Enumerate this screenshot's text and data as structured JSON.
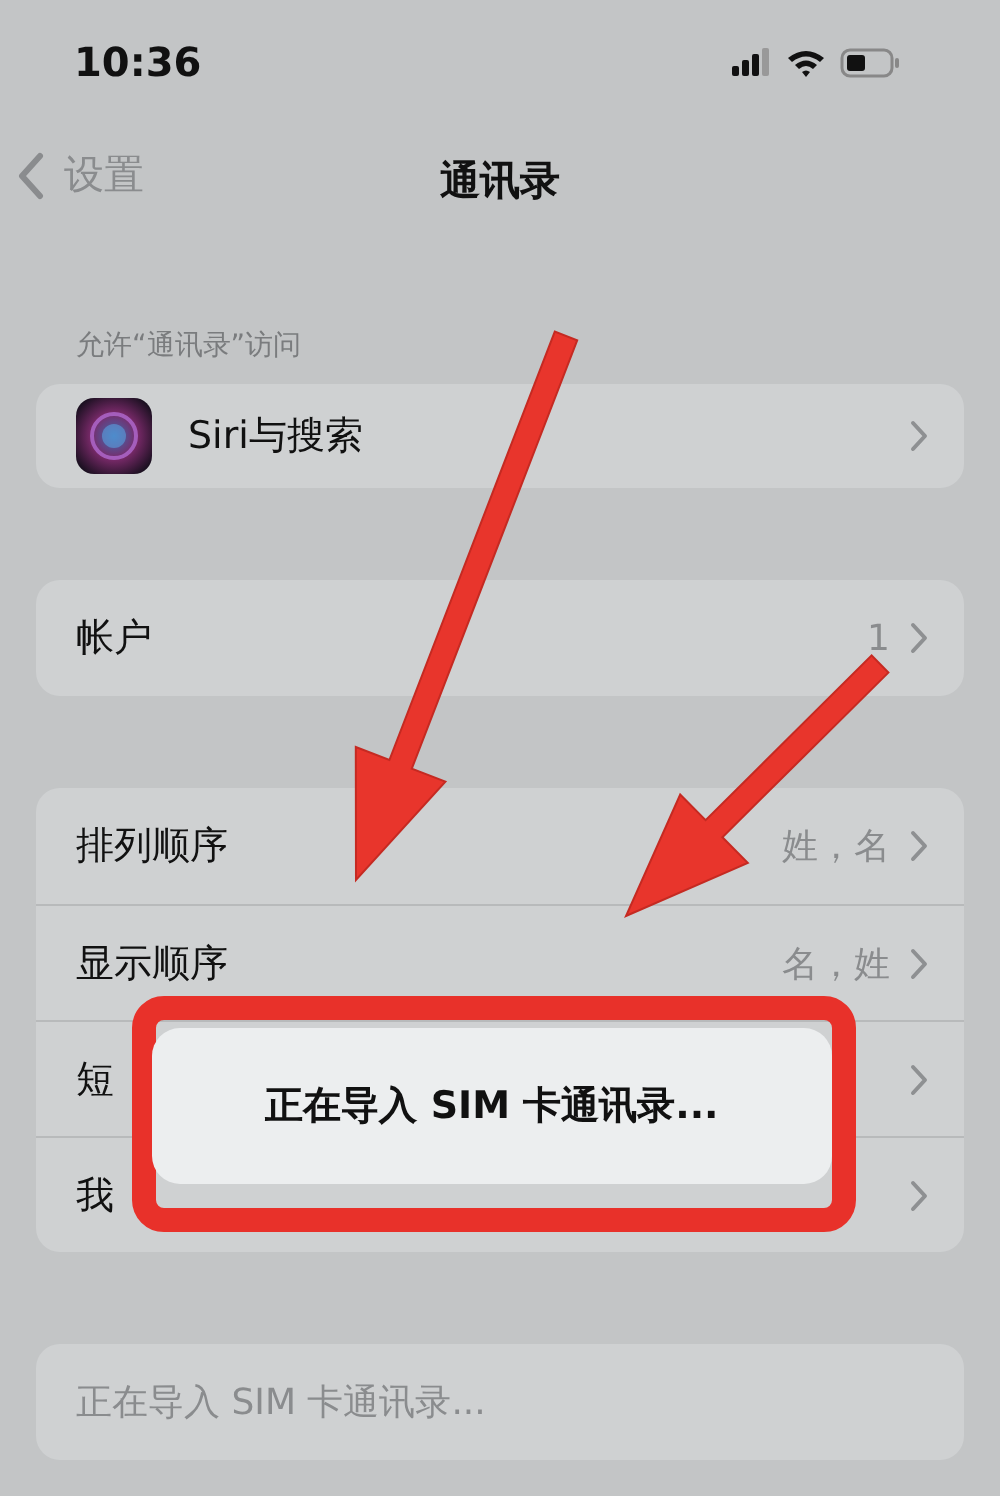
{
  "status_bar": {
    "time": "10:36"
  },
  "nav": {
    "back": "设置",
    "title": "通讯录"
  },
  "sections": [
    {
      "header": "允许“通讯录”访问",
      "rows": [
        {
          "kind": "app",
          "label": "Siri与搜索"
        }
      ]
    },
    {
      "rows": [
        {
          "kind": "link",
          "label": "帐户",
          "value": "1"
        }
      ]
    },
    {
      "rows": [
        {
          "kind": "link",
          "label": "排列顺序",
          "value": "姓，名"
        },
        {
          "kind": "link",
          "label": "显示顺序",
          "value": "名，姓"
        },
        {
          "kind": "link",
          "label": "短"
        },
        {
          "kind": "link",
          "label": "我"
        }
      ]
    },
    {
      "rows": [
        {
          "kind": "status",
          "label": "正在导入 SIM 卡通讯录..."
        }
      ]
    }
  ],
  "alert": {
    "message": "正在导入 SIM 卡通讯录..."
  }
}
